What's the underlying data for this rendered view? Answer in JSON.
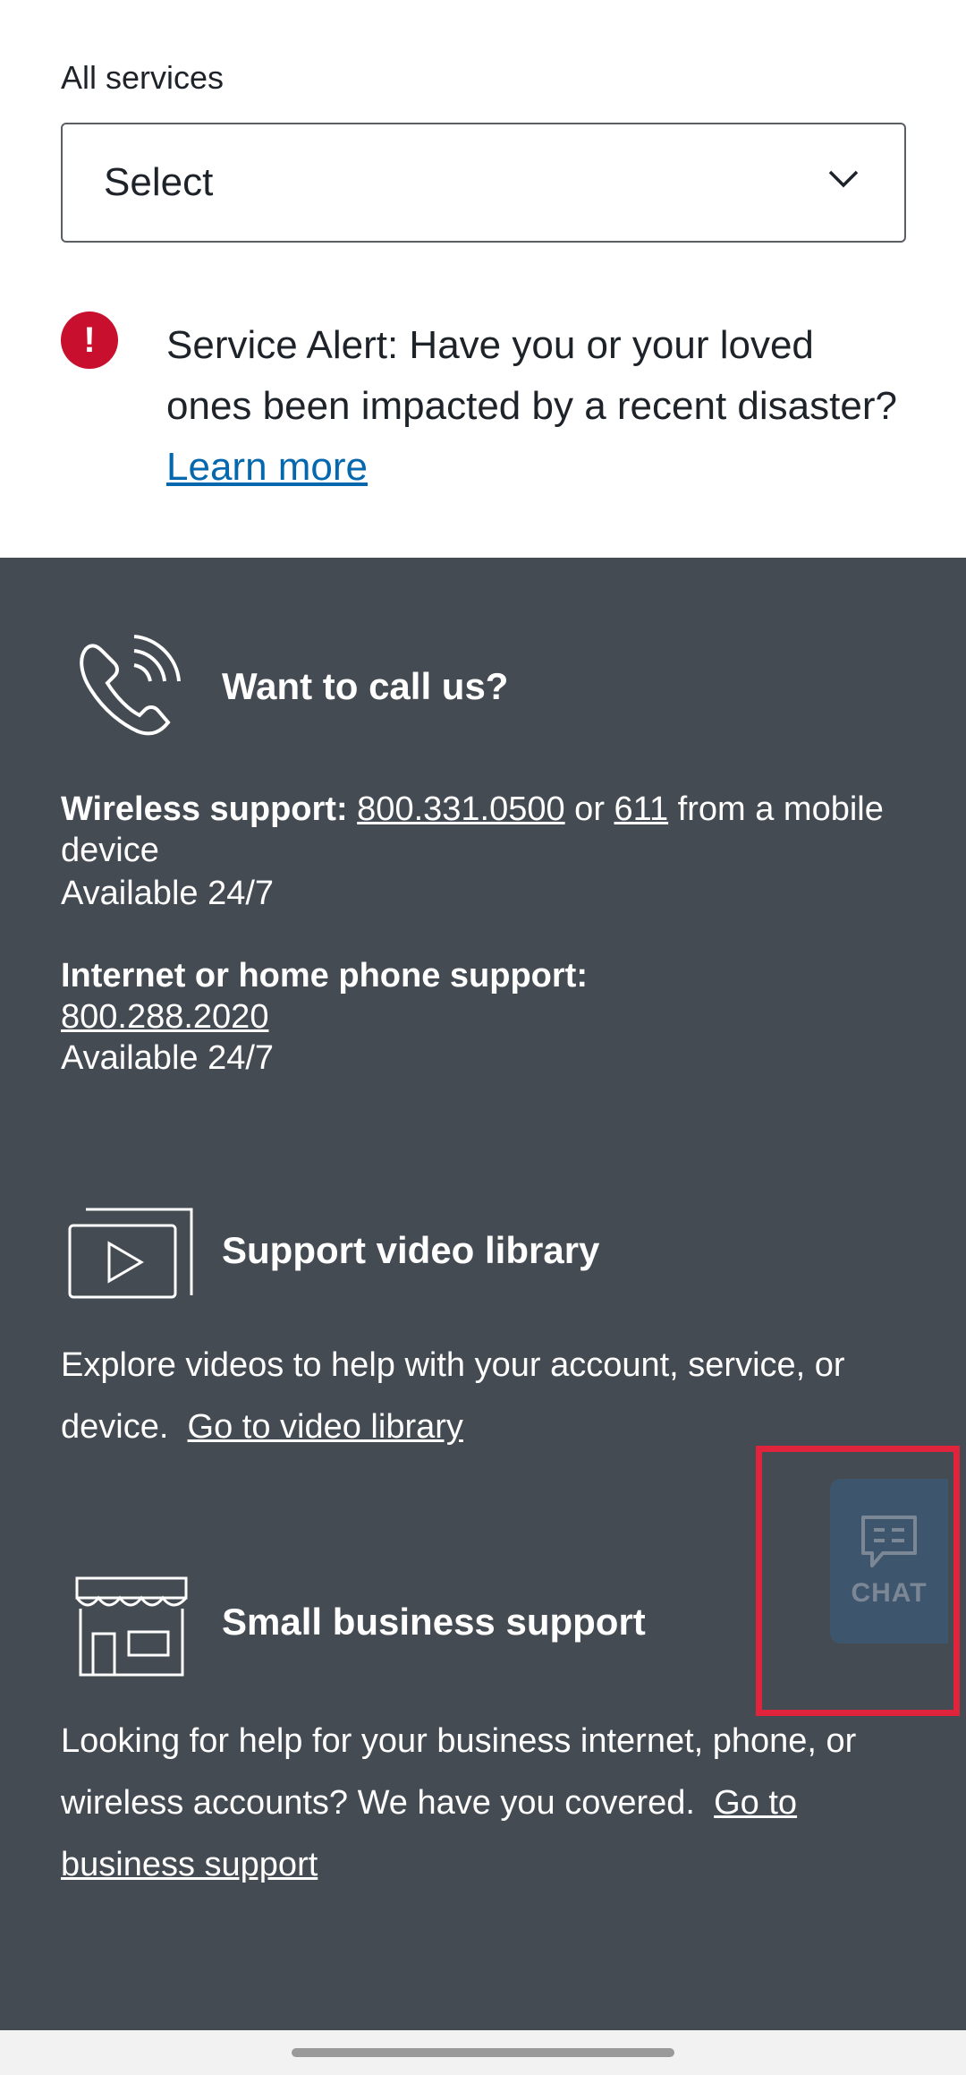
{
  "filter": {
    "label": "All services",
    "select_value": "Select"
  },
  "alert": {
    "text": "Service Alert: Have you or your loved ones been impacted by a recent disaster?",
    "link": "Learn more"
  },
  "call": {
    "title": "Want to call us?",
    "wireless_label": "Wireless support:",
    "wireless_number": "800.331.0500",
    "or_text": " or ",
    "short_number": "611",
    "from_text": " from a mobile device",
    "wireless_avail": "Available 24/7",
    "internet_label": "Internet or home phone support:",
    "internet_number": "800.288.2020",
    "internet_avail": "Available 24/7"
  },
  "video": {
    "title": "Support video library",
    "description": "Explore videos to help with your account, service, or device.",
    "link": "Go to video library"
  },
  "business": {
    "title": "Small business support",
    "description": "Looking for help for your business internet, phone, or wireless accounts? We have you covered.",
    "link": "Go to business support"
  },
  "chat": {
    "label": "CHAT"
  }
}
